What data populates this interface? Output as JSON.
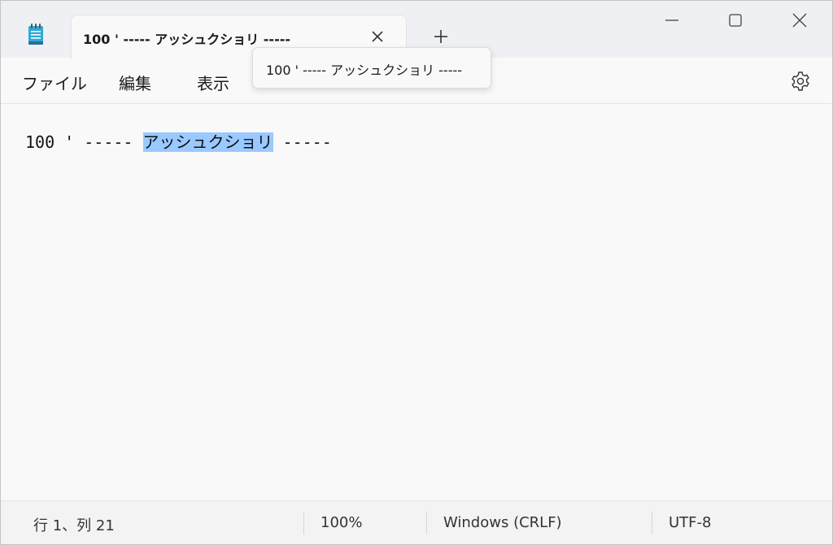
{
  "window": {
    "tab_title": "100 ' ----- アッシュクショリ -----",
    "new_tab_glyph": "+",
    "tooltip": "100 ' ----- アッシュクショリ -----"
  },
  "menu": {
    "items": [
      "ファイル",
      "編集",
      "表示"
    ]
  },
  "editor": {
    "before_selection": "100 ' ----- ",
    "selection": "アッシュクショリ",
    "after_selection": " -----"
  },
  "status": {
    "position": "行 1、列 21",
    "zoom": "100%",
    "line_ending": "Windows (CRLF)",
    "encoding": "UTF-8"
  },
  "icons": {
    "app": "notepad-icon",
    "close_tab": "close-icon",
    "new_tab": "plus-icon",
    "minimize": "minimize-icon",
    "maximize": "maximize-icon",
    "close_window": "close-icon",
    "settings": "gear-icon"
  },
  "colors": {
    "selection": "#99c9ff",
    "titlebar": "#eef0f3",
    "background": "#f9f9f9"
  }
}
